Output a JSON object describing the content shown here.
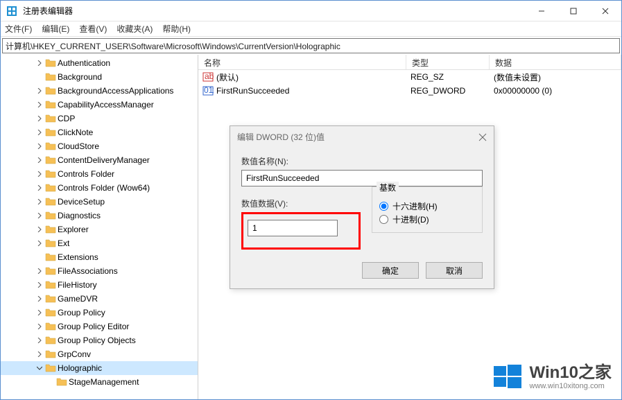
{
  "titlebar": {
    "title": "注册表编辑器"
  },
  "menu": {
    "file": "文件(F)",
    "edit": "编辑(E)",
    "view": "查看(V)",
    "favorites": "收藏夹(A)",
    "help": "帮助(H)"
  },
  "address": "计算机\\HKEY_CURRENT_USER\\Software\\Microsoft\\Windows\\CurrentVersion\\Holographic",
  "tree": [
    {
      "indent": 3,
      "exp": ">",
      "label": "Authentication"
    },
    {
      "indent": 3,
      "exp": "",
      "label": "Background"
    },
    {
      "indent": 3,
      "exp": ">",
      "label": "BackgroundAccessApplications"
    },
    {
      "indent": 3,
      "exp": ">",
      "label": "CapabilityAccessManager"
    },
    {
      "indent": 3,
      "exp": ">",
      "label": "CDP"
    },
    {
      "indent": 3,
      "exp": ">",
      "label": "ClickNote"
    },
    {
      "indent": 3,
      "exp": ">",
      "label": "CloudStore"
    },
    {
      "indent": 3,
      "exp": ">",
      "label": "ContentDeliveryManager"
    },
    {
      "indent": 3,
      "exp": ">",
      "label": "Controls Folder"
    },
    {
      "indent": 3,
      "exp": ">",
      "label": "Controls Folder (Wow64)"
    },
    {
      "indent": 3,
      "exp": ">",
      "label": "DeviceSetup"
    },
    {
      "indent": 3,
      "exp": ">",
      "label": "Diagnostics"
    },
    {
      "indent": 3,
      "exp": ">",
      "label": "Explorer"
    },
    {
      "indent": 3,
      "exp": ">",
      "label": "Ext"
    },
    {
      "indent": 3,
      "exp": "",
      "label": "Extensions"
    },
    {
      "indent": 3,
      "exp": ">",
      "label": "FileAssociations"
    },
    {
      "indent": 3,
      "exp": ">",
      "label": "FileHistory"
    },
    {
      "indent": 3,
      "exp": ">",
      "label": "GameDVR"
    },
    {
      "indent": 3,
      "exp": ">",
      "label": "Group Policy"
    },
    {
      "indent": 3,
      "exp": ">",
      "label": "Group Policy Editor"
    },
    {
      "indent": 3,
      "exp": ">",
      "label": "Group Policy Objects"
    },
    {
      "indent": 3,
      "exp": ">",
      "label": "GrpConv"
    },
    {
      "indent": 3,
      "exp": "v",
      "label": "Holographic",
      "selected": true
    },
    {
      "indent": 4,
      "exp": "",
      "label": "StageManagement"
    }
  ],
  "columns": {
    "name": "名称",
    "type": "类型",
    "data": "数据"
  },
  "values": [
    {
      "icon": "string",
      "name": "(默认)",
      "type": "REG_SZ",
      "data": "(数值未设置)"
    },
    {
      "icon": "dword",
      "name": "FirstRunSucceeded",
      "type": "REG_DWORD",
      "data": "0x00000000 (0)"
    }
  ],
  "dialog": {
    "title": "编辑 DWORD (32 位)值",
    "name_label": "数值名称(N):",
    "name_value": "FirstRunSucceeded",
    "data_label": "数值数据(V):",
    "data_value": "1",
    "base_label": "基数",
    "radio_hex": "十六进制(H)",
    "radio_dec": "十进制(D)",
    "ok": "确定",
    "cancel": "取消"
  },
  "watermark": {
    "main": "Win10之家",
    "sub": "www.win10xitong.com"
  }
}
